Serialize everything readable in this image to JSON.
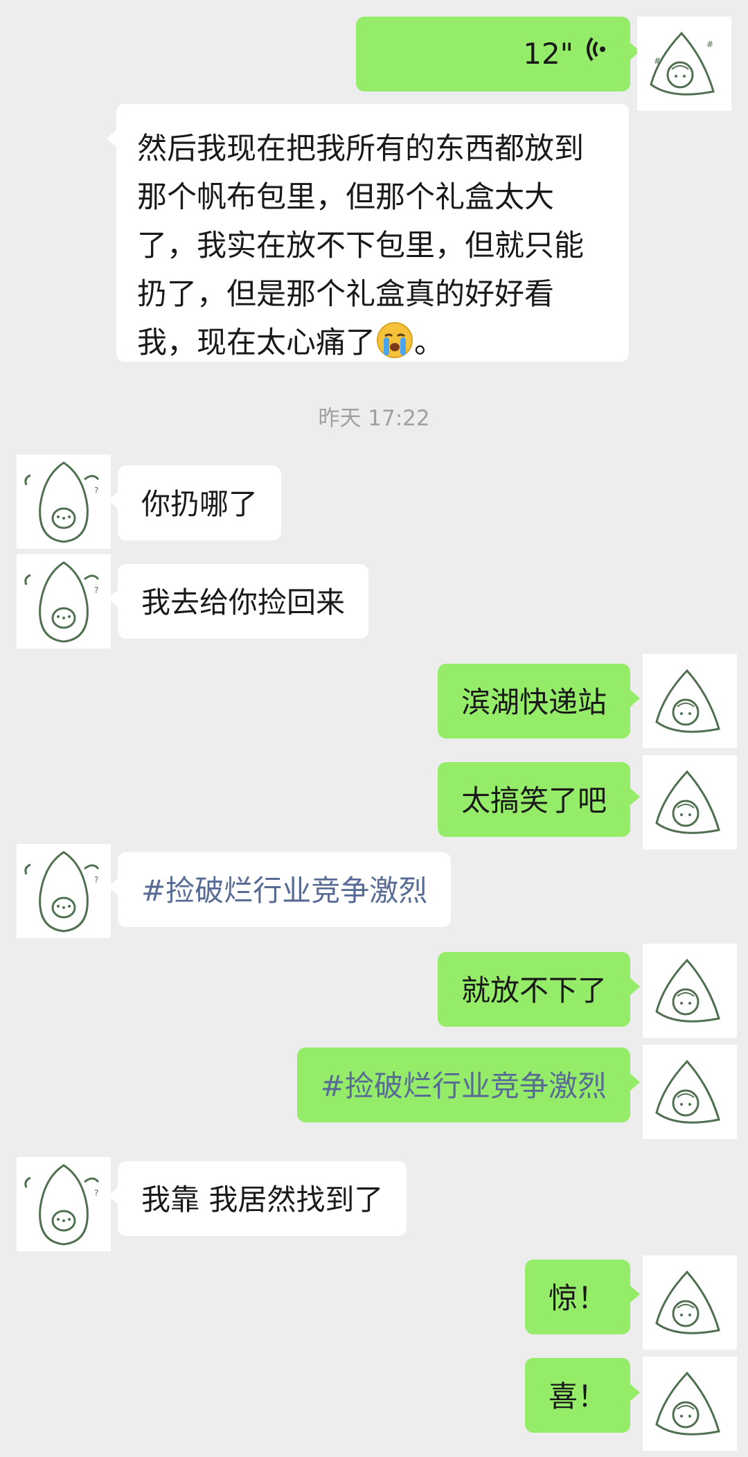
{
  "conversation": {
    "timestamp": "昨天 17:22",
    "messages": [
      {
        "id": "m1",
        "side": "out",
        "type": "voice",
        "duration": "12\""
      },
      {
        "id": "m2",
        "side": "in",
        "type": "text",
        "text_before_emoji": "然后我现在把我所有的东西都放到那个帆布包里，但那个礼盒太大了，我实在放不下包里，但就只能扔了，但是那个礼盒真的好好看我，现在太心痛了",
        "emoji": "crying-face",
        "text_after_emoji": "。"
      },
      {
        "id": "m3",
        "side": "in",
        "type": "text",
        "text": "你扔哪了"
      },
      {
        "id": "m4",
        "side": "in",
        "type": "text",
        "text": "我去给你捡回来"
      },
      {
        "id": "m5",
        "side": "out",
        "type": "text",
        "text": "滨湖快递站"
      },
      {
        "id": "m6",
        "side": "out",
        "type": "text",
        "text": "太搞笑了吧"
      },
      {
        "id": "m7",
        "side": "in",
        "type": "tag",
        "text": "#捡破烂行业竞争激烈"
      },
      {
        "id": "m8",
        "side": "out",
        "type": "text",
        "text": "就放不下了"
      },
      {
        "id": "m9",
        "side": "out",
        "type": "tag",
        "text": "#捡破烂行业竞争激烈"
      },
      {
        "id": "m10",
        "side": "in",
        "type": "text",
        "text": "我靠 我居然找到了"
      },
      {
        "id": "m11",
        "side": "out",
        "type": "text",
        "text": "惊！"
      },
      {
        "id": "m12",
        "side": "out",
        "type": "text",
        "text": "喜！"
      }
    ]
  },
  "colors": {
    "background": "#ededed",
    "incoming_bubble": "#ffffff",
    "outgoing_bubble": "#95ec69",
    "tag_text": "#576b95",
    "timestamp_text": "#a0a0a0",
    "avatar_line": "#4f6f4f"
  },
  "icons": {
    "voice": "voice-wave-icon",
    "incoming_avatar": "avocado-avatar-icon",
    "outgoing_avatar": "girl-hood-avatar-icon"
  }
}
